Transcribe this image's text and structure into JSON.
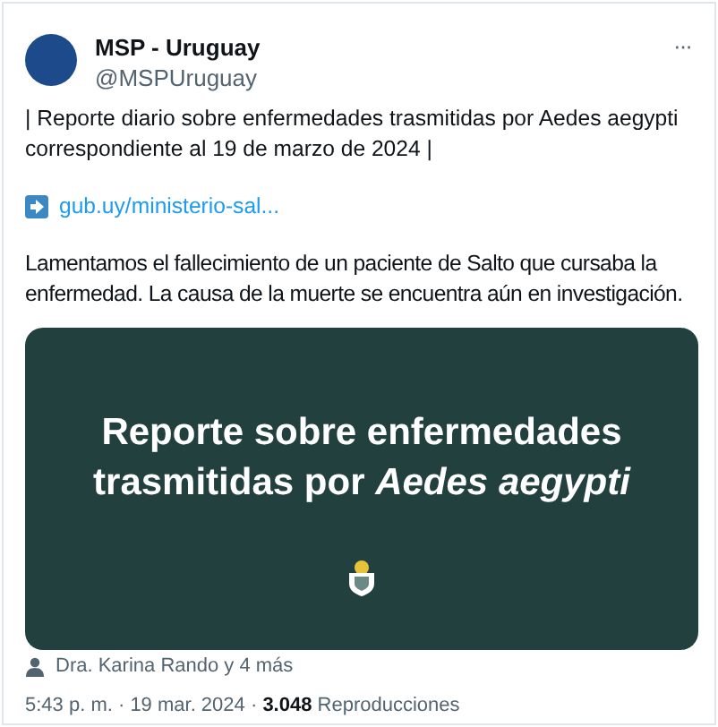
{
  "author": {
    "name": "MSP - Uruguay",
    "handle": "@MSPUruguay"
  },
  "more_button": "···",
  "text_lines": [
    "| Reporte diario sobre enfermedades trasmitidas por Aedes aegypti correspondiente al 19 de marzo de 2024 |"
  ],
  "link": "gub.uy/ministerio-sal...",
  "paragraph": "Lamentamos el fallecimiento de un paciente de Salto que cursaba la enfermedad. La causa de la muerte se encuentra aún en investigación.",
  "media": {
    "title": "Reporte sobre enfermedades trasmitidas por *Aedes aegypti*"
  },
  "tagged": "Dra. Karina Rando y 4 más",
  "meta": "5:43 p. m. · 19 mar. 2024 · **3.048** Reproducciones"
}
